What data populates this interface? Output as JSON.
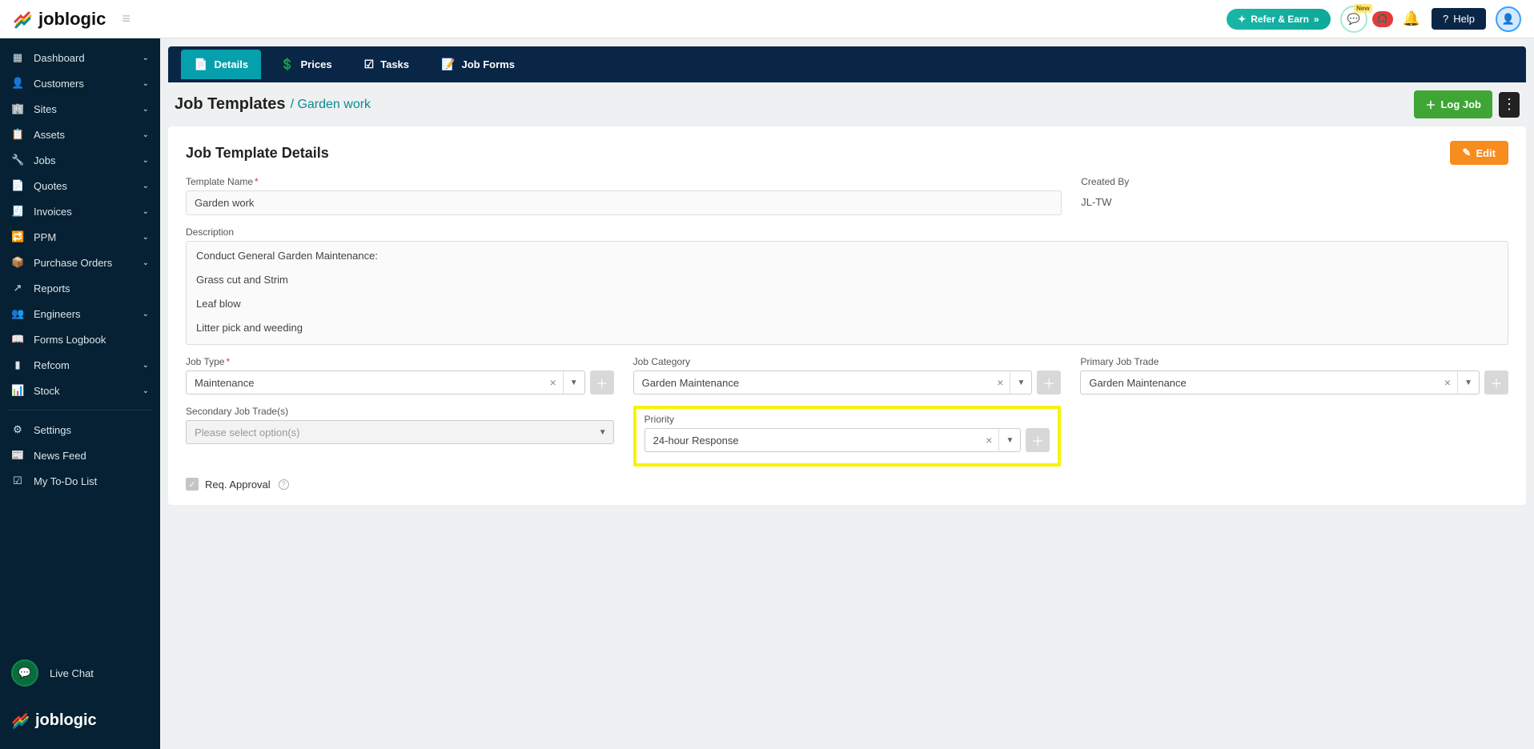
{
  "header": {
    "brand": "joblogic",
    "refer_label": "Refer & Earn",
    "new_badge": "New",
    "help_label": "Help"
  },
  "sidebar": {
    "items": [
      {
        "icon": "▦",
        "label": "Dashboard",
        "expandable": true
      },
      {
        "icon": "👤",
        "label": "Customers",
        "expandable": true
      },
      {
        "icon": "🏢",
        "label": "Sites",
        "expandable": true
      },
      {
        "icon": "📋",
        "label": "Assets",
        "expandable": true
      },
      {
        "icon": "🔧",
        "label": "Jobs",
        "expandable": true
      },
      {
        "icon": "📄",
        "label": "Quotes",
        "expandable": true
      },
      {
        "icon": "🧾",
        "label": "Invoices",
        "expandable": true
      },
      {
        "icon": "🔁",
        "label": "PPM",
        "expandable": true
      },
      {
        "icon": "📦",
        "label": "Purchase Orders",
        "expandable": true
      },
      {
        "icon": "↗",
        "label": "Reports",
        "expandable": false
      },
      {
        "icon": "👥",
        "label": "Engineers",
        "expandable": true
      },
      {
        "icon": "📖",
        "label": "Forms Logbook",
        "expandable": false
      },
      {
        "icon": "▮",
        "label": "Refcom",
        "expandable": true
      },
      {
        "icon": "📊",
        "label": "Stock",
        "expandable": true
      }
    ],
    "secondary": [
      {
        "icon": "⚙",
        "label": "Settings"
      },
      {
        "icon": "📰",
        "label": "News Feed"
      },
      {
        "icon": "☑",
        "label": "My To-Do List"
      }
    ],
    "livechat_label": "Live Chat"
  },
  "tabs": [
    {
      "icon": "📄",
      "label": "Details",
      "active": true
    },
    {
      "icon": "💲",
      "label": "Prices",
      "active": false
    },
    {
      "icon": "☑",
      "label": "Tasks",
      "active": false
    },
    {
      "icon": "📝",
      "label": "Job Forms",
      "active": false
    }
  ],
  "breadcrumb": {
    "root": "Job Templates",
    "current": "Garden work",
    "log_job": "Log Job"
  },
  "card": {
    "title": "Job Template Details",
    "edit_label": "Edit",
    "fields": {
      "template_name_label": "Template Name",
      "template_name_value": "Garden work",
      "created_by_label": "Created By",
      "created_by_value": "JL-TW",
      "description_label": "Description",
      "description_value": "Conduct General Garden Maintenance:\n\nGrass cut and Strim\n\nLeaf blow\n\nLitter pick and weeding",
      "job_type_label": "Job Type",
      "job_type_value": "Maintenance",
      "job_category_label": "Job Category",
      "job_category_value": "Garden Maintenance",
      "primary_trade_label": "Primary Job Trade",
      "primary_trade_value": "Garden Maintenance",
      "secondary_trade_label": "Secondary Job Trade(s)",
      "secondary_trade_placeholder": "Please select option(s)",
      "priority_label": "Priority",
      "priority_value": "24-hour Response",
      "req_approval_label": "Req. Approval"
    }
  }
}
